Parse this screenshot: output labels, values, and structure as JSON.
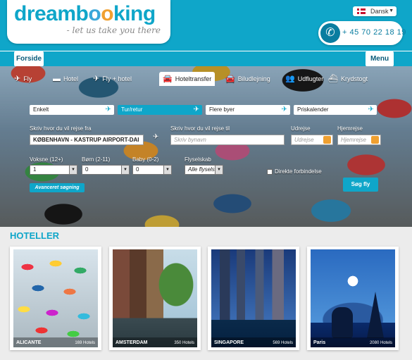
{
  "header": {
    "logo_dream": "dream",
    "logo_b": "b",
    "logo_o1": "o",
    "logo_o2": "o",
    "logo_king": "king",
    "tagline": "- let us take you there",
    "language": "Dansk",
    "phone": "+ 45 70 22 18 19",
    "brand_color": "#0fa6c9"
  },
  "nav": {
    "home": "Forside",
    "menu": "Menu"
  },
  "search": {
    "tabs": [
      {
        "label": "Fly",
        "icon": "plane-icon"
      },
      {
        "label": "Hotel",
        "icon": "bed-icon"
      },
      {
        "label": "Fly + hotel",
        "icon": "plane-bed-icon"
      },
      {
        "label": "Hoteltransfer",
        "icon": "car-icon",
        "active": true
      },
      {
        "label": "Biludlejning",
        "icon": "car-icon"
      },
      {
        "label": "Udflugter",
        "icon": "people-icon"
      },
      {
        "label": "Krydstogt",
        "icon": "ship-icon"
      }
    ],
    "trip_types": {
      "one_way": "Enkelt",
      "round_trip": "Tur/retur",
      "multi_city": "Flere byer",
      "price_calendar": "Priskalender"
    },
    "from_label": "Skriv hvor du vil rejse fra",
    "from_value": "KØBENHAVN - KASTRUP AIRPORT-DAI",
    "to_label": "Skriv hvor du vil rejse til",
    "to_placeholder": "Skriv bynavn",
    "depart_label": "Udrejse",
    "depart_placeholder": "Udrejse",
    "return_label": "Hjemrejse",
    "return_placeholder": "Hjemrejse",
    "adults_label": "Voksne (12+)",
    "adults_value": "1",
    "children_label": "Børn (2-11)",
    "children_value": "0",
    "babies_label": "Baby (0-2)",
    "babies_value": "0",
    "airline_label": "Flyselskab",
    "airline_value": "Alle flyselsk",
    "direct_label": "Direkte forbindelse",
    "advanced_button": "Avanceret søgning",
    "search_button": "Søg fly"
  },
  "hotels": {
    "title": "HOTELLER",
    "cards": [
      {
        "city": "ALICANTE",
        "count": "169 Hotels"
      },
      {
        "city": "AMSTERDAM",
        "count": "350 Hotels"
      },
      {
        "city": "SINGAPORE",
        "count": "569 Hotels"
      },
      {
        "city": "Paris",
        "count": "2080 Hotels"
      }
    ]
  }
}
